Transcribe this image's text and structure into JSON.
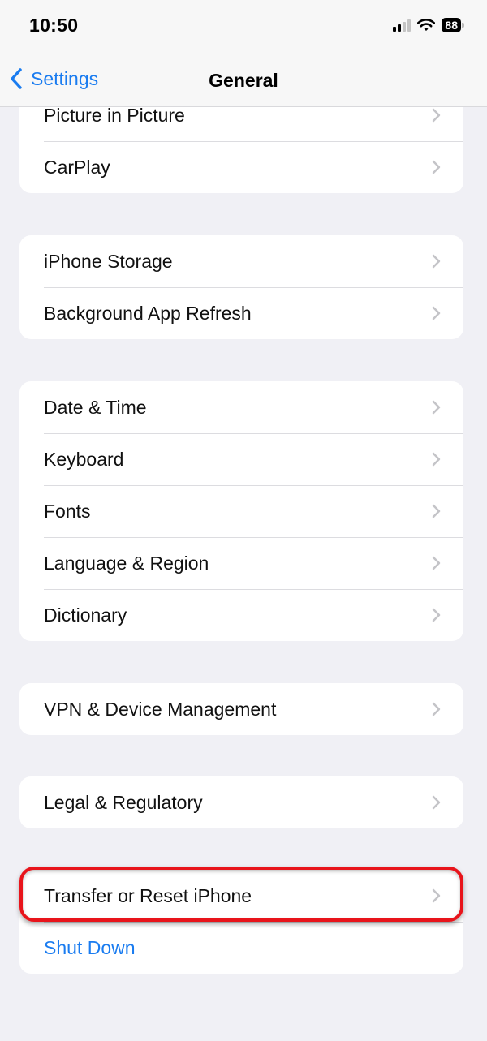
{
  "status_bar": {
    "time": "10:50",
    "battery_level": "88",
    "signal_bars_active": 2,
    "signal_bars_total": 4,
    "icons": [
      "cellular-signal-icon",
      "wifi-icon",
      "battery-icon"
    ]
  },
  "nav": {
    "back_label": "Settings",
    "back_icon": "chevron-left-icon",
    "title": "General"
  },
  "groups": [
    {
      "items": [
        {
          "label": "Picture in Picture"
        },
        {
          "label": "CarPlay"
        }
      ]
    },
    {
      "items": [
        {
          "label": "iPhone Storage"
        },
        {
          "label": "Background App Refresh"
        }
      ]
    },
    {
      "items": [
        {
          "label": "Date & Time"
        },
        {
          "label": "Keyboard"
        },
        {
          "label": "Fonts"
        },
        {
          "label": "Language & Region"
        },
        {
          "label": "Dictionary"
        }
      ]
    },
    {
      "items": [
        {
          "label": "VPN & Device Management"
        }
      ]
    },
    {
      "items": [
        {
          "label": "Legal & Regulatory"
        }
      ]
    },
    {
      "items": [
        {
          "label": "Transfer or Reset iPhone",
          "highlighted": true
        },
        {
          "label": "Shut Down",
          "style": "link"
        }
      ]
    }
  ],
  "colors": {
    "accent": "#1a7cf0",
    "highlight_outline": "#e8141b",
    "background": "#f0f0f5"
  }
}
